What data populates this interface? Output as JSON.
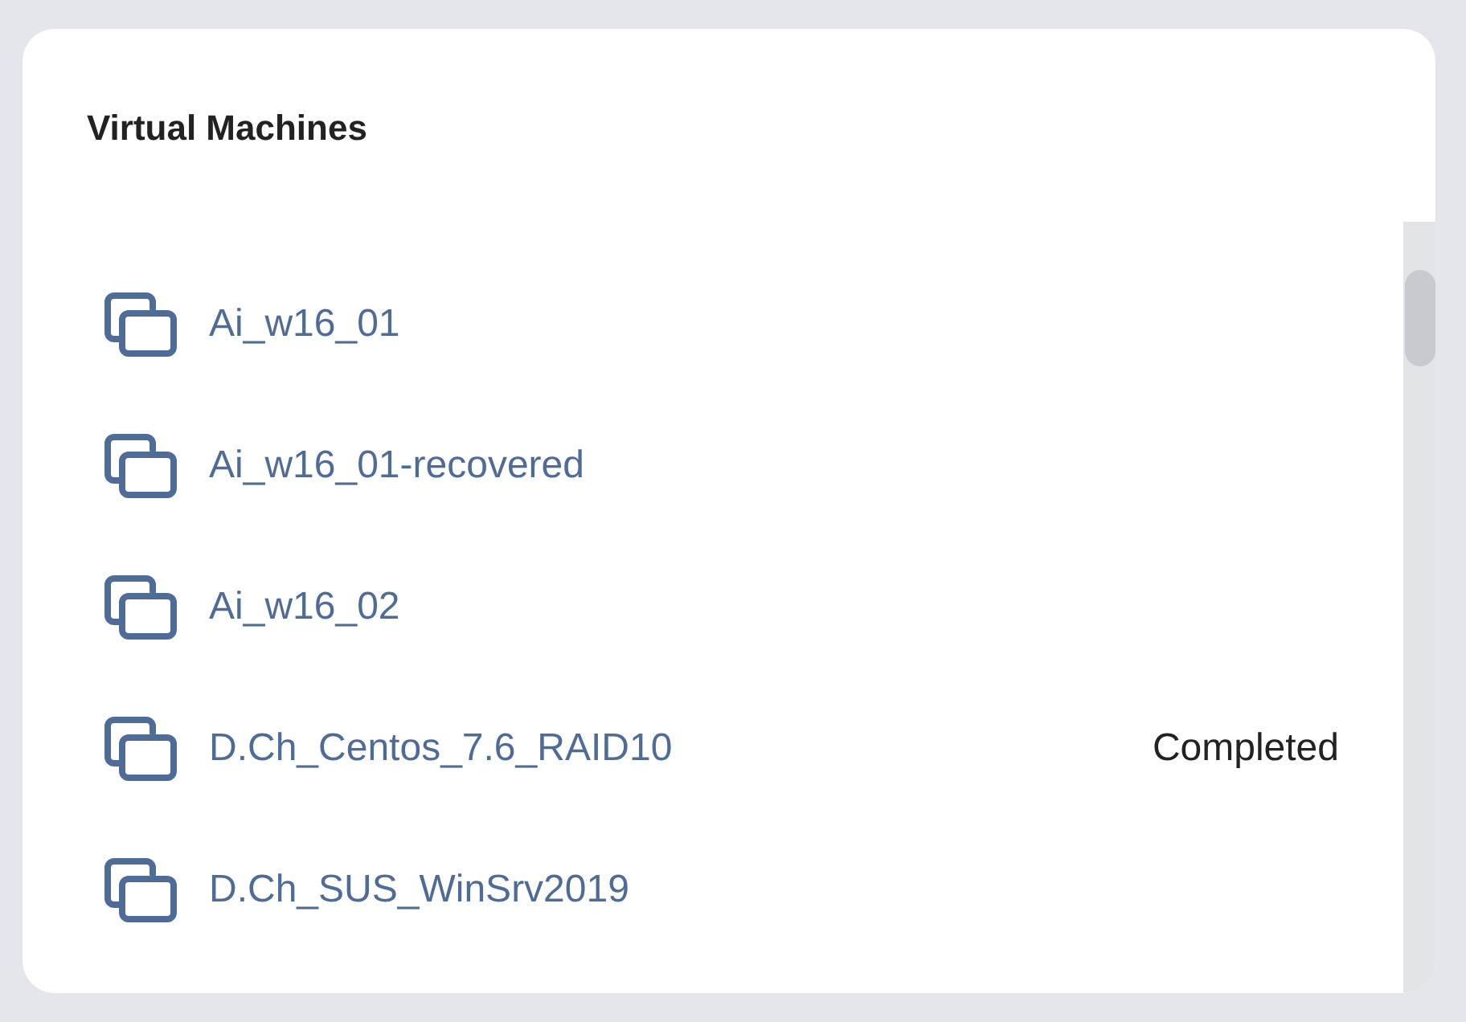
{
  "title": "Virtual Machines",
  "machines": [
    {
      "name": "Ai_w16_01"
    },
    {
      "name": "Ai_w16_01-recovered"
    },
    {
      "name": "Ai_w16_02"
    },
    {
      "name": "D.Ch_Centos_7.6_RAID10",
      "status": "Completed"
    },
    {
      "name": "D.Ch_SUS_WinSrv2019"
    }
  ]
}
